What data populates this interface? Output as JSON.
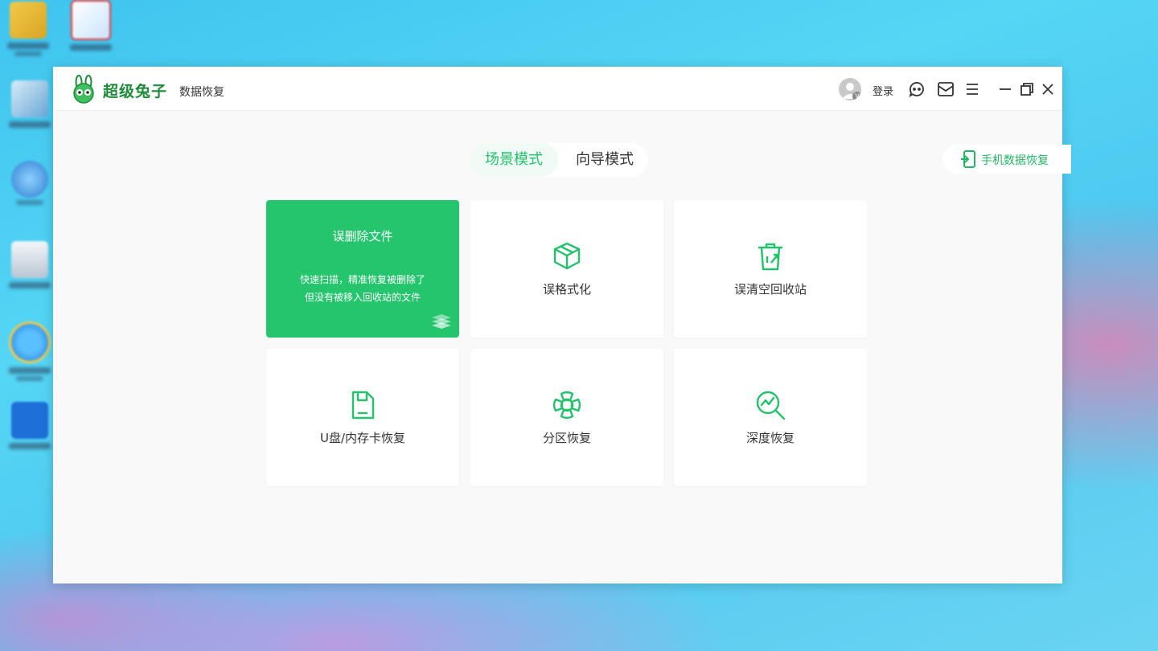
{
  "app": {
    "brand_name": "超级兔子",
    "brand_subtitle": "数据恢复",
    "login_label": "登录",
    "avatar_badge": "V",
    "accent_color": "#23c16b"
  },
  "toolbar_icons": [
    "feedback-icon",
    "mail-icon",
    "menu-icon",
    "minimize-icon",
    "restore-icon",
    "close-icon"
  ],
  "modes": {
    "active_label": "场景模式",
    "inactive_label": "向导模式"
  },
  "phone_recovery": {
    "label": "手机数据恢复"
  },
  "cards": [
    {
      "title": "误删除文件",
      "desc_line1": "快速扫描，精准恢复被删除了",
      "desc_line2": "但没有被移入回收站的文件",
      "selected": true
    },
    {
      "title": "误格式化",
      "icon": "cube-icon"
    },
    {
      "title": "误清空回收站",
      "icon": "recycle-bin-icon"
    },
    {
      "title": "U盘/内存卡恢复",
      "icon": "sd-card-icon"
    },
    {
      "title": "分区恢复",
      "icon": "partition-icon"
    },
    {
      "title": "深度恢复",
      "icon": "deep-scan-icon"
    }
  ]
}
